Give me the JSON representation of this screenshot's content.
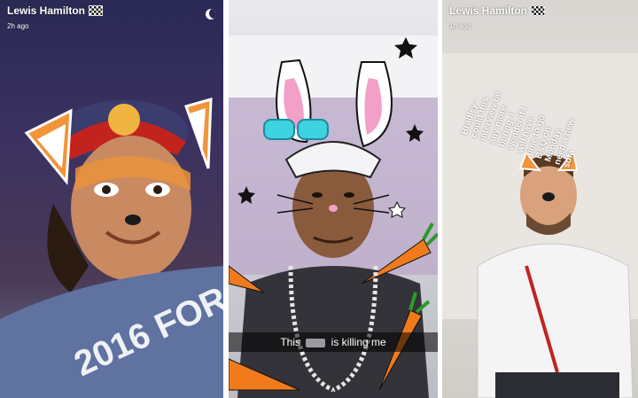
{
  "panel1": {
    "username": "Lewis Hamilton",
    "time_ago": "2h ago"
  },
  "panel2": {
    "caption_before": "This",
    "caption_after": "is killing me"
  },
  "panel3": {
    "username": "Lewis Hamilton",
    "time_ago": "1h ago",
    "story_text_lines": [
      "Bradley -",
      "could this",
      "interview be",
      "any more",
      "boring. I",
      "wonder if I",
      "will have",
      "time to go",
      "B&Q on",
      "Monday,",
      "need a new",
      "sofa"
    ]
  },
  "colors": {
    "overlay_text": "#ffffff",
    "caption_bar": "rgba(0,0,0,0.55)",
    "carrot": "#f07a1c",
    "bunny_ear_inner": "#f3a0c8",
    "glasses": "#3fd2e0"
  },
  "icons": {
    "checkered_flag": "checkered-flag-icon",
    "moon": "moon-icon"
  }
}
